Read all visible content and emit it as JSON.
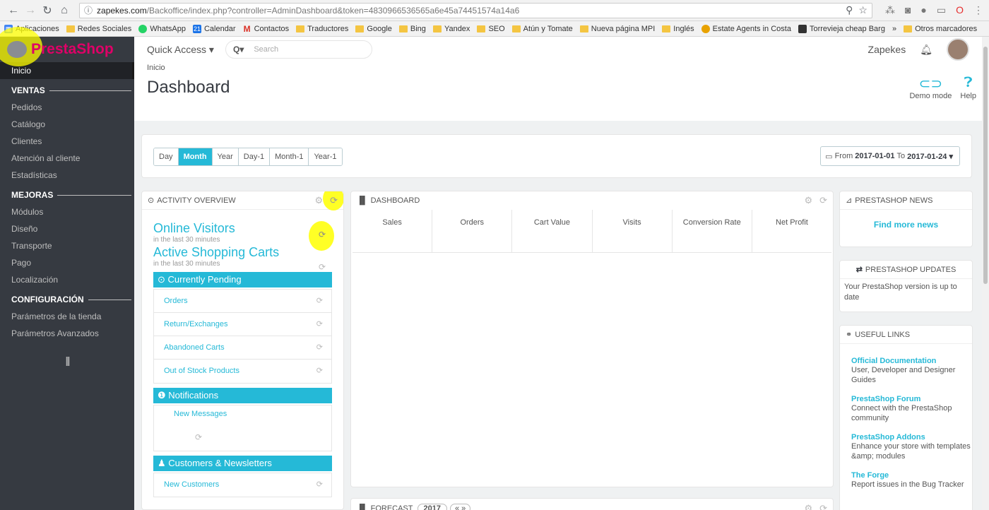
{
  "browser": {
    "url_host": "zapekes.com",
    "url_path": "/Backoffice/index.php?controller=AdminDashboard&token=4830966536565a6e45a74451574a14a6",
    "bookmarks": [
      "Aplicaciones",
      "Redes Sociales",
      "WhatsApp",
      "Calendar",
      "Contactos",
      "Traductores",
      "Google",
      "Bing",
      "Yandex",
      "SEO",
      "Atún y Tomate",
      "Nueva página MPI",
      "Inglés",
      "Estate Agents in Costa",
      "Torrevieja cheap Barg",
      "»",
      "Otros marcadores"
    ]
  },
  "logo": "PrestaShop",
  "header": {
    "quick_access": "Quick Access ▾",
    "search_placeholder": "Search",
    "user": "Zapekes"
  },
  "sidebar": {
    "inicio": "Inicio",
    "ventas": "VENTAS",
    "ventas_items": [
      "Pedidos",
      "Catálogo",
      "Clientes",
      "Atención al cliente",
      "Estadísticas"
    ],
    "mejoras": "MEJORAS",
    "mejoras_items": [
      "Módulos",
      "Diseño",
      "Transporte",
      "Pago",
      "Localización"
    ],
    "config": "CONFIGURACIÓN",
    "config_items": [
      "Parámetros de la tienda",
      "Parámetros Avanzados"
    ]
  },
  "page": {
    "breadcrumb": "Inicio",
    "title": "Dashboard",
    "demo_mode": "Demo mode",
    "help": "Help"
  },
  "ranges": [
    "Day",
    "Month",
    "Year",
    "Day-1",
    "Month-1",
    "Year-1"
  ],
  "active_range": "Month",
  "date_filter": {
    "from_label": "From",
    "from": "2017-01-01",
    "to_label": "To",
    "to": "2017-01-24 ▾"
  },
  "activity": {
    "heading": "ACTIVITY OVERVIEW",
    "online_visitors": "Online Visitors",
    "online_sub": "in the last 30 minutes",
    "active_carts": "Active Shopping Carts",
    "carts_sub": "in the last 30 minutes",
    "pending": "Currently Pending",
    "pending_items": [
      "Orders",
      "Return/Exchanges",
      "Abandoned Carts",
      "Out of Stock Products"
    ],
    "notifications": "Notifications",
    "new_messages": "New Messages",
    "customers": "Customers & Newsletters",
    "new_customers": "New Customers"
  },
  "dashboard": {
    "heading": "DASHBOARD",
    "columns": [
      "Sales",
      "Orders",
      "Cart Value",
      "Visits",
      "Conversion Rate",
      "Net Profit"
    ]
  },
  "forecast": {
    "heading": "FORECAST",
    "year": "2017"
  },
  "news": {
    "heading": "PRESTASHOP NEWS",
    "link": "Find more news"
  },
  "updates": {
    "heading": "PRESTASHOP UPDATES",
    "text": "Your PrestaShop version is up to date"
  },
  "useful": {
    "heading": "USEFUL LINKS",
    "links": [
      {
        "title": "Official Documentation",
        "desc": "User, Developer and Designer Guides"
      },
      {
        "title": "PrestaShop Forum",
        "desc": "Connect with the PrestaShop community"
      },
      {
        "title": "PrestaShop Addons",
        "desc": "Enhance your store with templates &amp; modules"
      },
      {
        "title": "The Forge",
        "desc": "Report issues in the Bug Tracker"
      }
    ]
  },
  "colors": {
    "accent": "#25b9d7",
    "sidebar": "#363a41",
    "brand": "#df0067",
    "highlight": "#ffff00"
  }
}
